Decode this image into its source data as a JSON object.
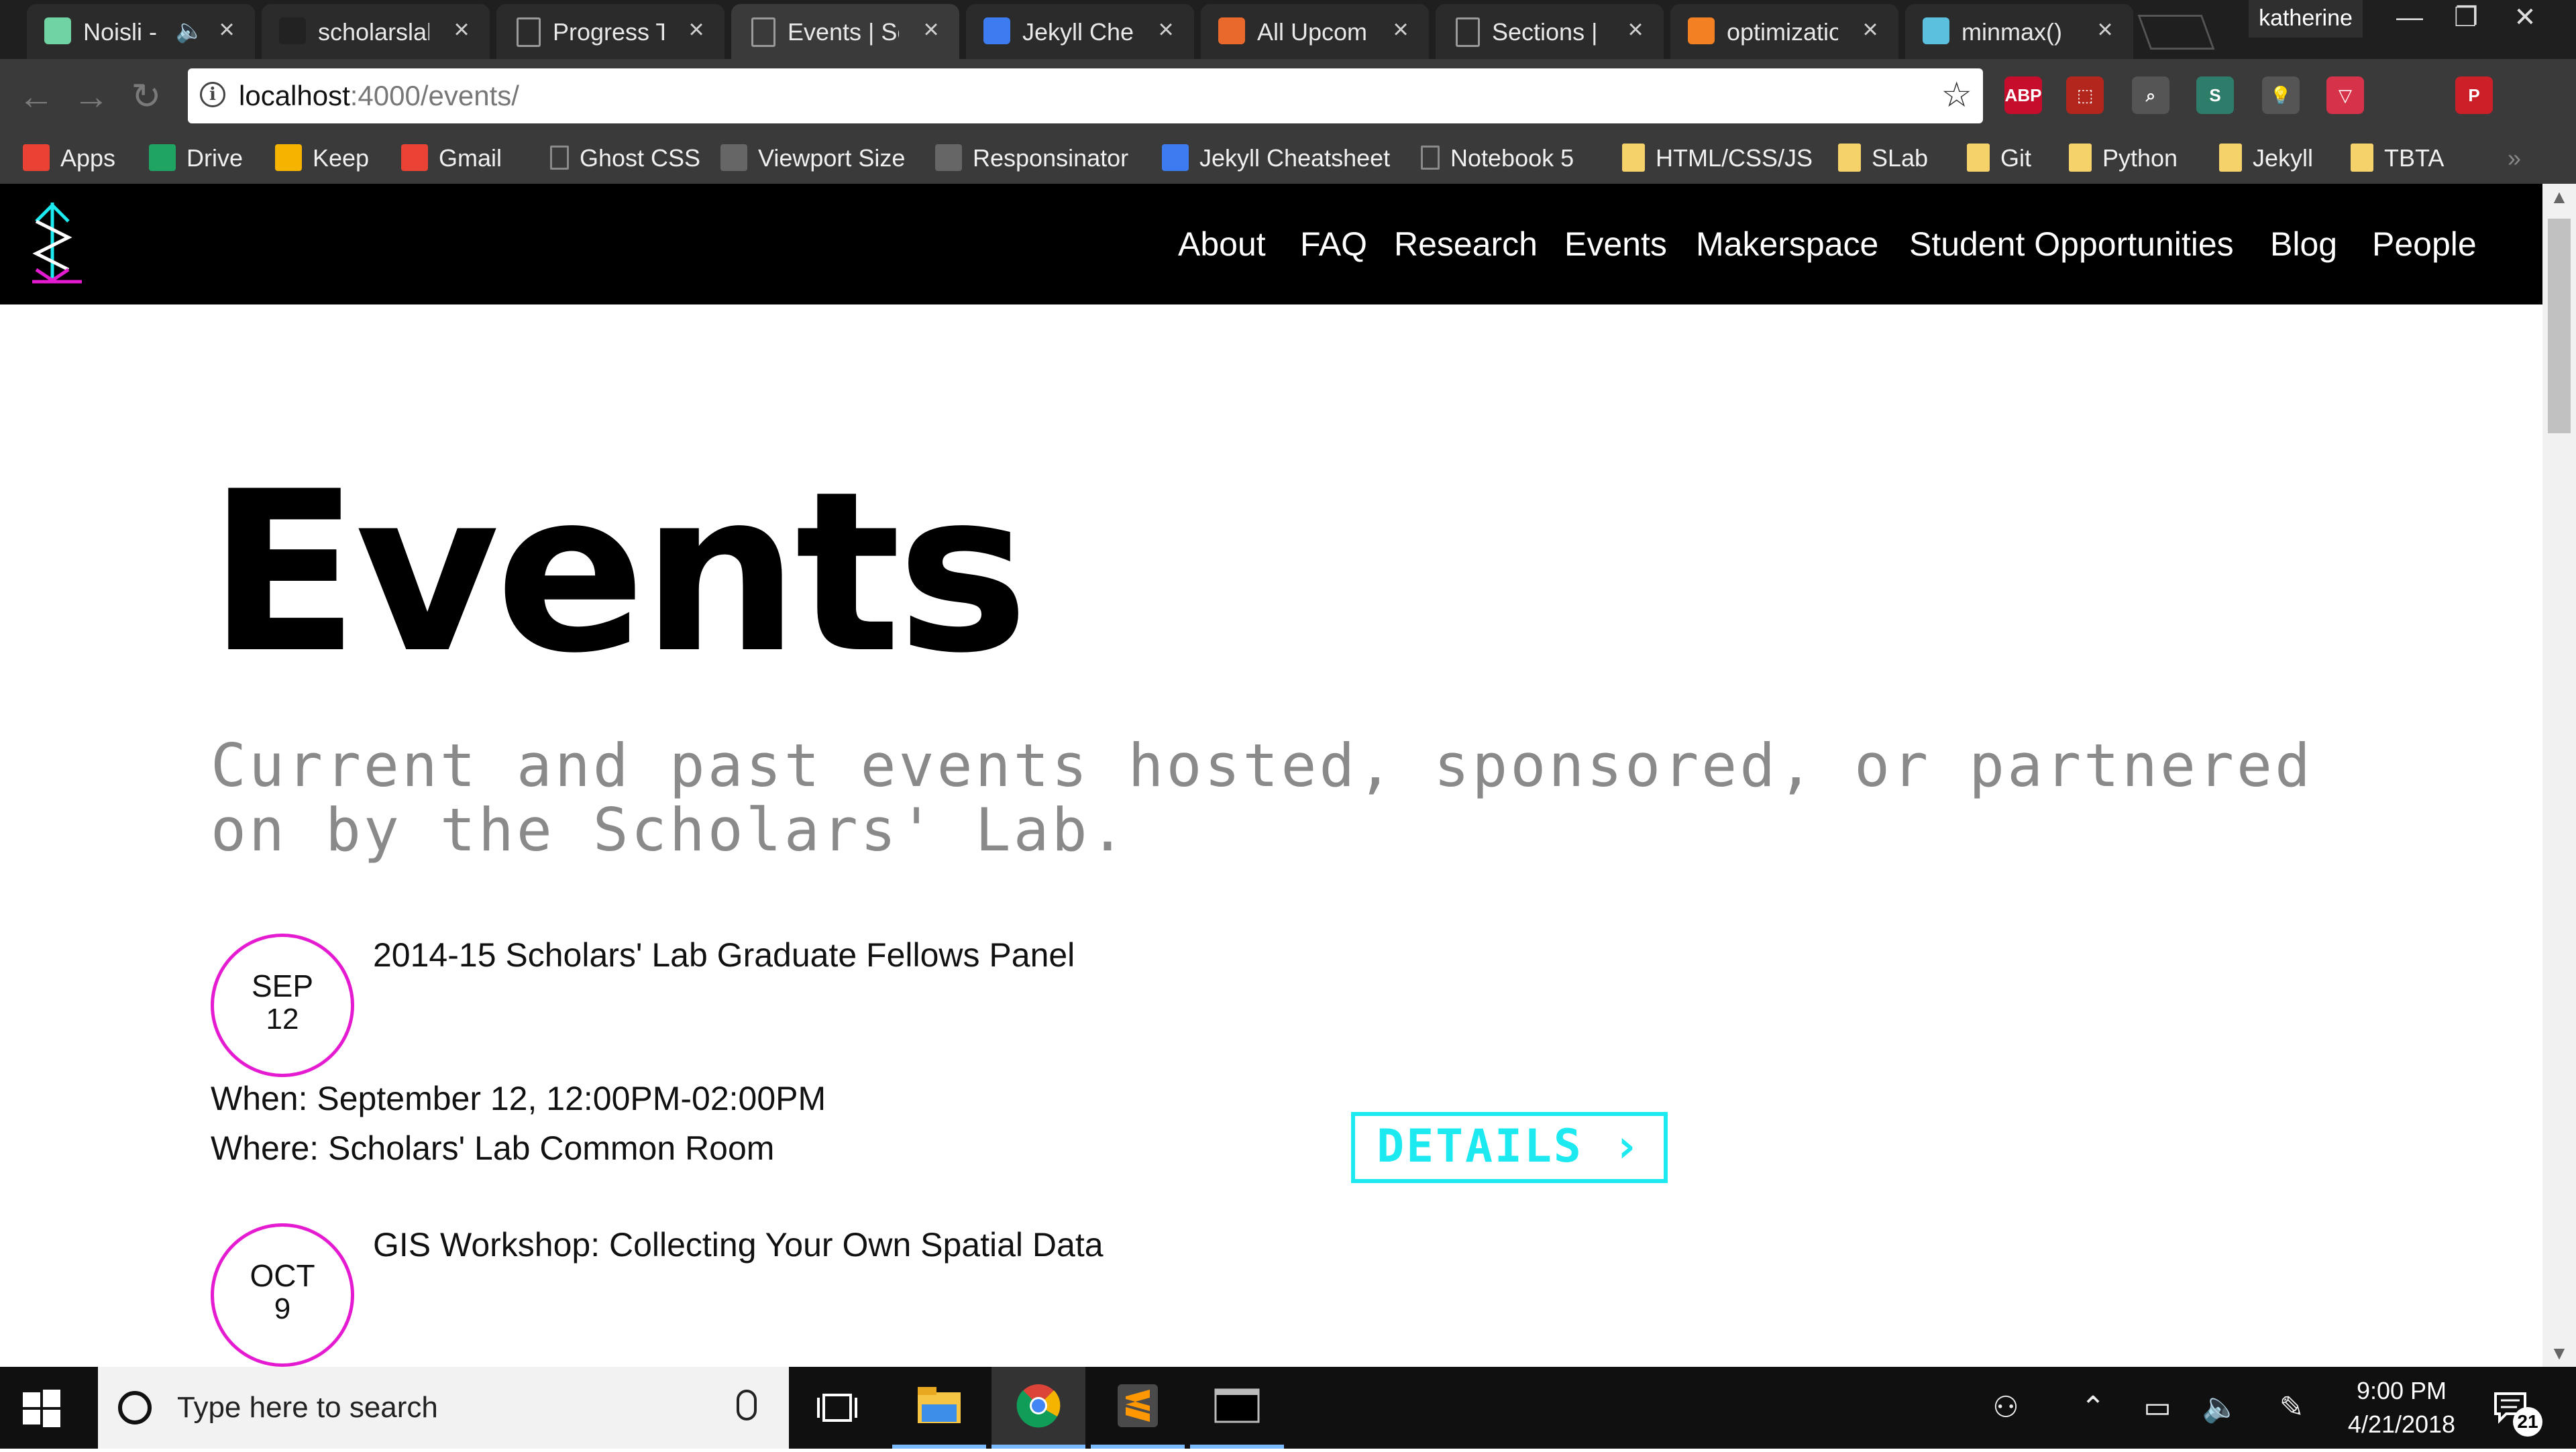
{
  "browser": {
    "tabs": [
      {
        "title": "Noisli -",
        "icon": "noisli-icon",
        "color": "#6fd3a3",
        "muted": true
      },
      {
        "title": "scholarslab",
        "icon": "github-icon",
        "color": "#222222"
      },
      {
        "title": "Progress T",
        "icon": "document-icon"
      },
      {
        "title": "Events | Sc",
        "icon": "document-icon",
        "active": true
      },
      {
        "title": "Jekyll Chea",
        "icon": "jekyll-cheatsheet-icon",
        "color": "#3d7bf0"
      },
      {
        "title": "All Upcom",
        "icon": "meetup-icon",
        "color": "#e8692b"
      },
      {
        "title": "Sections |",
        "icon": "document-icon"
      },
      {
        "title": "optimizatio",
        "icon": "stackoverflow-icon",
        "color": "#f48024"
      },
      {
        "title": "minmax()",
        "icon": "mdn-icon",
        "color": "#5bc0de"
      }
    ],
    "user": "katherine",
    "window_controls": {
      "minimize": "—",
      "restore": "❐",
      "close": "✕"
    },
    "url_host": "localhost",
    "url_path": ":4000/events/",
    "info_glyph": "i",
    "star_glyph": "☆",
    "extensions": [
      {
        "name": "adblock-plus-icon",
        "label": "ABP",
        "color": "#c70d2c"
      },
      {
        "name": "pdf-icon",
        "label": "⬚",
        "color": "#b3261e"
      },
      {
        "name": "search-extension-icon",
        "label": "⌕",
        "color": "#555555"
      },
      {
        "name": "s-extension-icon",
        "label": "S",
        "color": "#2e7d6b"
      },
      {
        "name": "lightbulb-icon",
        "label": "💡",
        "color": "#555555"
      },
      {
        "name": "pocket-icon",
        "label": "▽",
        "color": "#d6334a"
      },
      {
        "name": "pinterest-icon",
        "label": "P",
        "color": "#cb2027"
      }
    ],
    "bookmarks": [
      {
        "label": "Apps",
        "icon": "apps-grid-icon",
        "color": "#e94235"
      },
      {
        "label": "Drive",
        "icon": "drive-icon",
        "color": "#1fa463"
      },
      {
        "label": "Keep",
        "icon": "keep-icon",
        "color": "#f6b400"
      },
      {
        "label": "Gmail",
        "icon": "gmail-icon",
        "color": "#ea4335"
      },
      {
        "label": "Ghost CSS",
        "icon": "document-icon"
      },
      {
        "label": "Viewport Size",
        "icon": "viewport-icon",
        "color": "#666666"
      },
      {
        "label": "Responsinator",
        "icon": "responsinator-icon",
        "color": "#666666"
      },
      {
        "label": "Jekyll Cheatsheet",
        "icon": "jekyll-cheatsheet-icon",
        "color": "#3d7bf0"
      },
      {
        "label": "Notebook 5",
        "icon": "document-icon"
      },
      {
        "label": "HTML/CSS/JS",
        "icon": "folder-icon"
      },
      {
        "label": "SLab",
        "icon": "folder-icon"
      },
      {
        "label": "Git",
        "icon": "folder-icon"
      },
      {
        "label": "Python",
        "icon": "folder-icon"
      },
      {
        "label": "Jekyll",
        "icon": "folder-icon"
      },
      {
        "label": "TBTA",
        "icon": "folder-icon"
      }
    ],
    "bookmarks_overflow": "»"
  },
  "site": {
    "nav": [
      "About",
      "FAQ",
      "Research",
      "Events",
      "Makerspace",
      "Student Opportunities",
      "Blog",
      "People"
    ],
    "logo_colors": {
      "primary": "#1de9f0",
      "accent": "#e41bd1"
    }
  },
  "page": {
    "title": "Events",
    "subtitle": "Current and past events hosted, sponsored, or partnered on by the Scholars' Lab.",
    "events": [
      {
        "month": "SEP",
        "day": "12",
        "title": "2014-15 Scholars' Lab Graduate Fellows Panel",
        "when": "When: September 12, 12:00PM-02:00PM",
        "where": "Where: Scholars' Lab Common Room",
        "details": "DETAILS ›"
      },
      {
        "month": "OCT",
        "day": "9",
        "title": "GIS Workshop: Collecting Your Own Spatial Data"
      }
    ],
    "colors": {
      "accent_magenta": "#e41bd1",
      "accent_cyan": "#1de9f0",
      "subtitle_gray": "#8a8a8a"
    }
  },
  "taskbar": {
    "search_placeholder": "Type here to search",
    "apps": [
      "task-view-icon",
      "file-explorer-icon",
      "chrome-icon",
      "sublime-text-icon",
      "terminal-icon"
    ],
    "time": "9:00 PM",
    "date": "4/21/2018",
    "notification_count": "21"
  }
}
